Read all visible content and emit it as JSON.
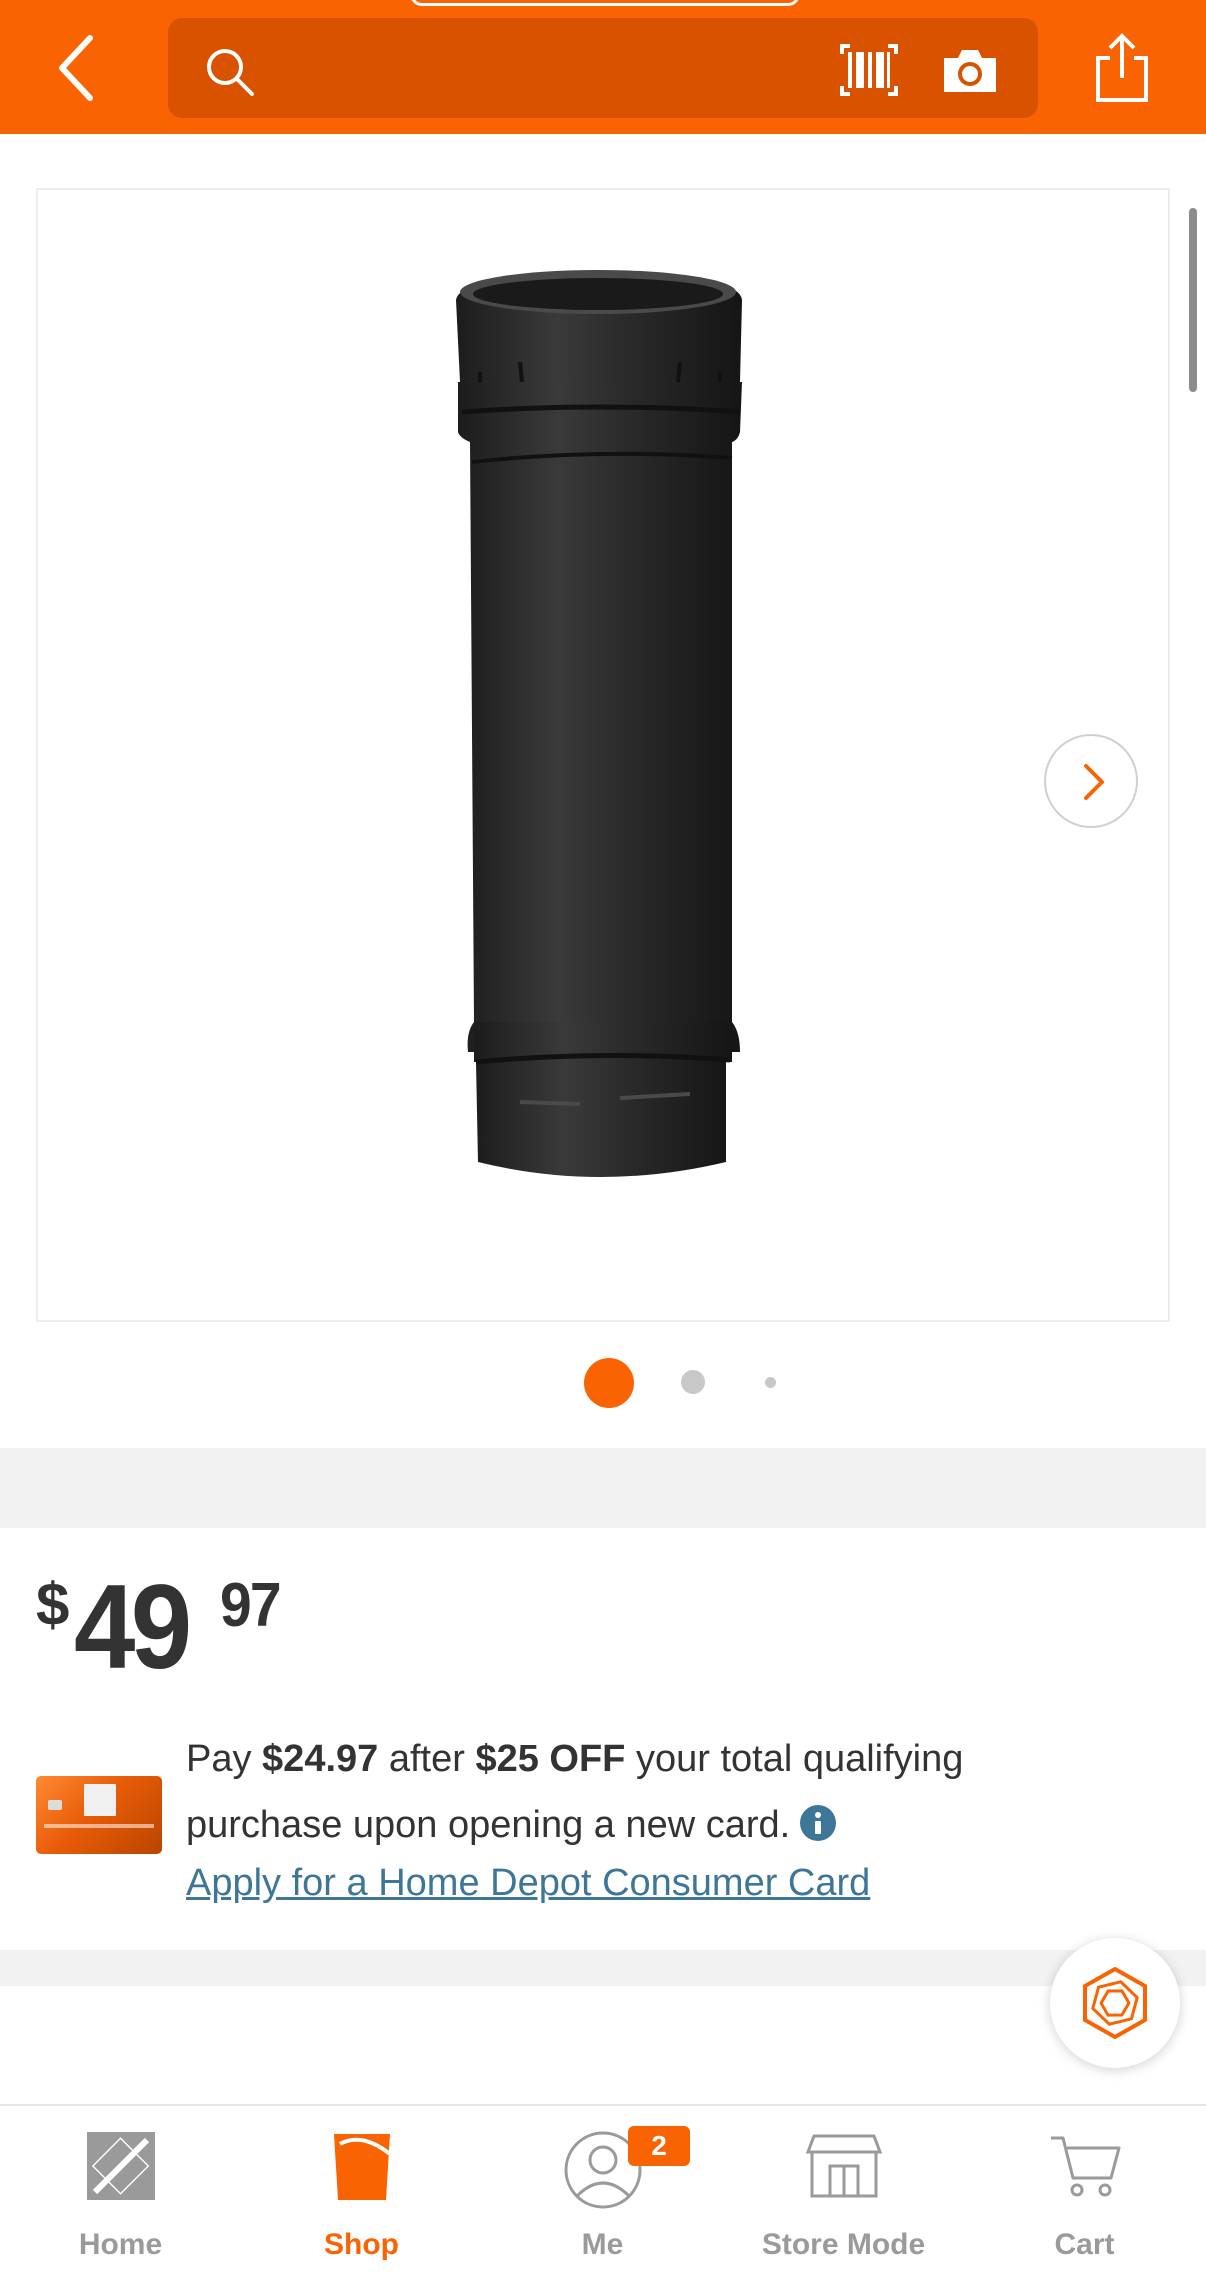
{
  "header": {
    "back_icon": "chevron-left-icon",
    "search_icon": "search-icon",
    "search_placeholder": "",
    "barcode_icon": "barcode-scan-icon",
    "camera_icon": "camera-icon",
    "share_icon": "share-icon",
    "accent_color": "#f96302"
  },
  "gallery": {
    "image_alt": "black stove pipe",
    "pages": 3,
    "active_page": 1,
    "next_icon": "chevron-right-icon"
  },
  "price": {
    "currency": "$",
    "dollars": "49",
    "cents": "97"
  },
  "promo": {
    "pay_text": "Pay",
    "pay_amount": "$24.97",
    "after_text": "after",
    "off_amount": "$25 OFF",
    "rest_line1": "your total qualifying",
    "rest_line2": "purchase upon opening a new card.",
    "link_text": "Apply for a Home Depot Consumer Card"
  },
  "nav": {
    "items": [
      {
        "label": "Home",
        "icon": "home-depot-logo-icon"
      },
      {
        "label": "Shop",
        "icon": "bucket-icon"
      },
      {
        "label": "Me",
        "icon": "user-icon"
      },
      {
        "label": "Store Mode",
        "icon": "store-icon"
      },
      {
        "label": "Cart",
        "icon": "cart-icon"
      }
    ],
    "me_badge": "2",
    "active": "Shop"
  }
}
